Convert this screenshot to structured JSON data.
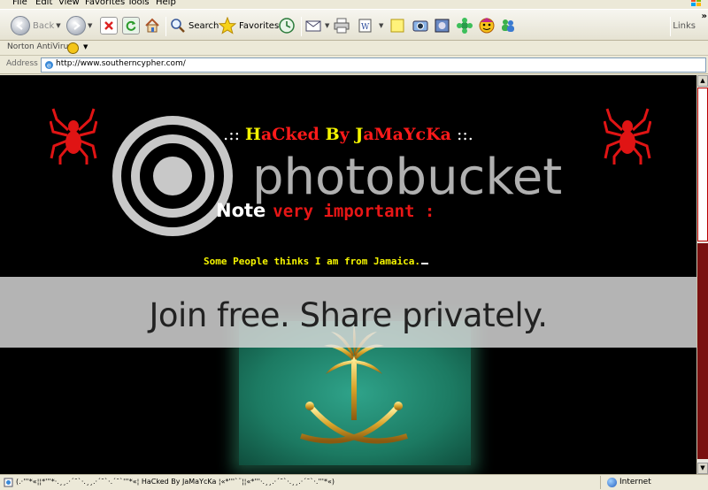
{
  "menu": [
    "File",
    "Edit",
    "View",
    "Favorites",
    "Tools",
    "Help"
  ],
  "toolbar": {
    "back_label": "Back",
    "search_label": "Search",
    "favorites_label": "Favorites",
    "links_label": "Links",
    "chevron": "»"
  },
  "norton": {
    "label": "Norton AntiVirus"
  },
  "address": {
    "label": "Address",
    "url": "http://www.southerncypher.com/"
  },
  "page": {
    "title_parts": [
      ".:: ",
      "H",
      "aCked ",
      "B",
      "y ",
      "J",
      "aMaYcKa",
      " ::."
    ],
    "note_word": "Note",
    "important_text": "very important :",
    "jamaica_text": "Some People thinks I am from Jamaica."
  },
  "watermark": {
    "logo_text": "photobucket",
    "join_text": "Join free. Share privately."
  },
  "status": {
    "text": "(.·'''*«¦¦*'''*·.¸¸.·´¯`·.¸¸.·´¯`·.´¯`'''*«¦ HaCked By JaMaYcKa ¦«*'''`¨¦¦«*'''·.¸¸.·´¯`·.¸¸.·´¯`·.'''*«)",
    "zone": "Internet"
  },
  "colors": {
    "page_bg": "#000000",
    "yellow": "#f5f500",
    "red": "#ff1a1a",
    "flag_green": "#1c7a62"
  }
}
